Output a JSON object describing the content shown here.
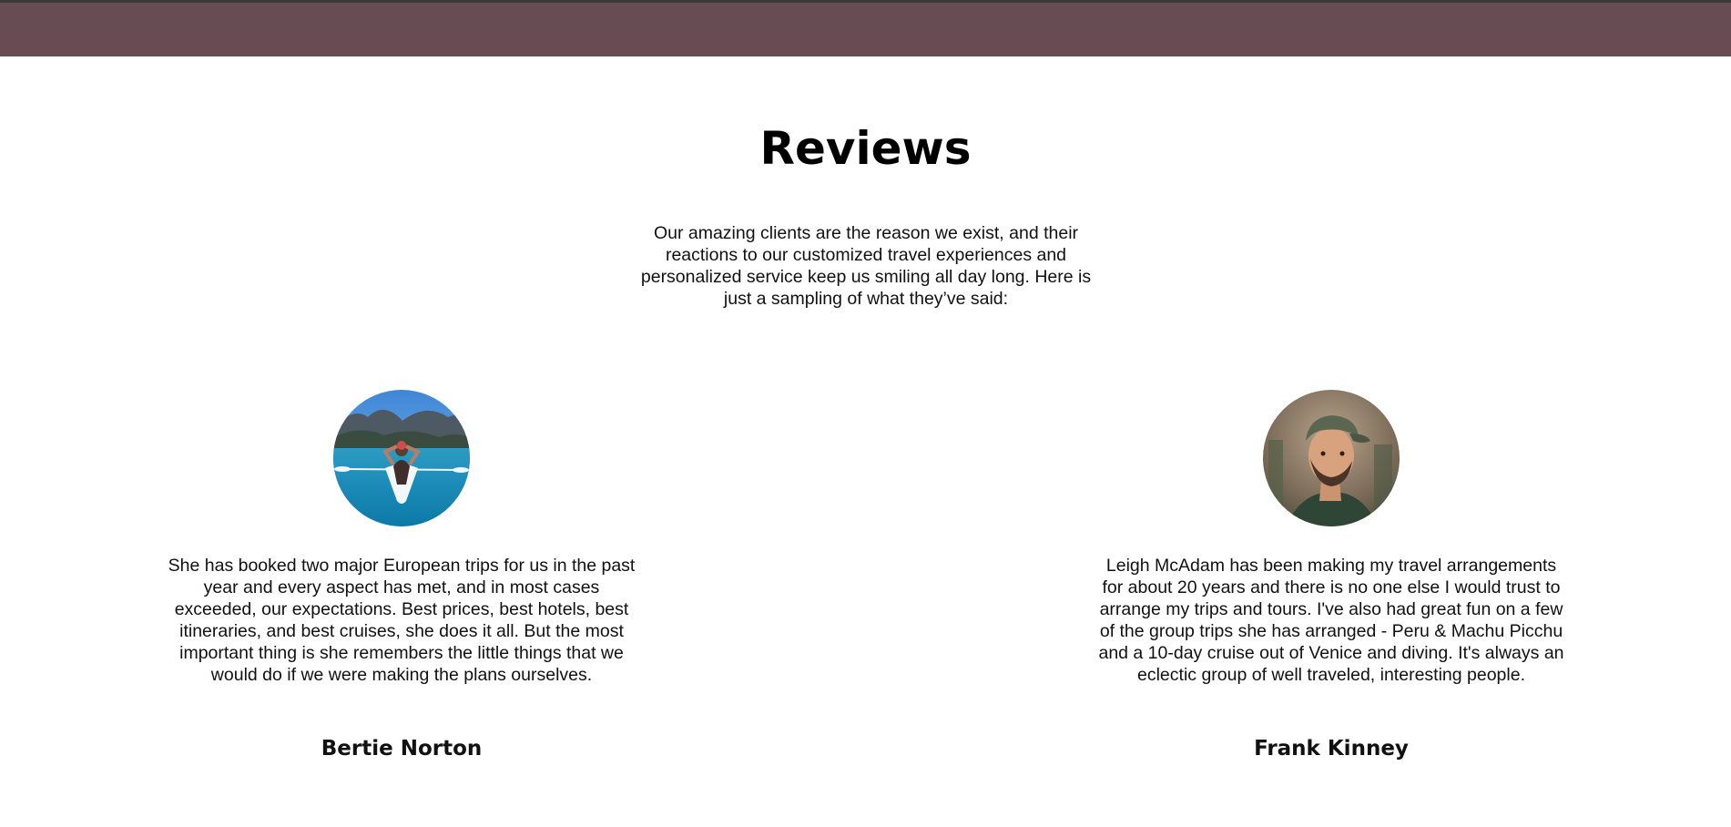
{
  "header": {
    "bar_color": "#674c53"
  },
  "page": {
    "title": "Reviews",
    "intro": "Our amazing clients are the reason we exist, and their reactions to our customized travel experiences and personalized service keep us smiling all day long. Here is just a sampling of what they’ve said:"
  },
  "reviews": [
    {
      "avatar_icon": "kayak-photo",
      "text": "She has booked two major European trips for us in the past year and every aspect has met, and in most cases exceeded, our expectations. Best prices, best hotels, best itineraries, and best cruises, she does it all. But the most important thing is she remembers the little things that we would do if we were making the plans ourselves.",
      "name": "Bertie Norton"
    },
    {
      "avatar_icon": "portrait-photo",
      "text": "Leigh McAdam has been making my travel arrangements for about 20 years and there is no one else I would trust to arrange my trips and tours. I've also had great fun on a few of the group trips she has arranged - Peru & Machu Picchu and a 10-day cruise out of Venice and diving. It's always an eclectic group of well traveled, interesting people.",
      "name": "Frank Kinney"
    }
  ]
}
